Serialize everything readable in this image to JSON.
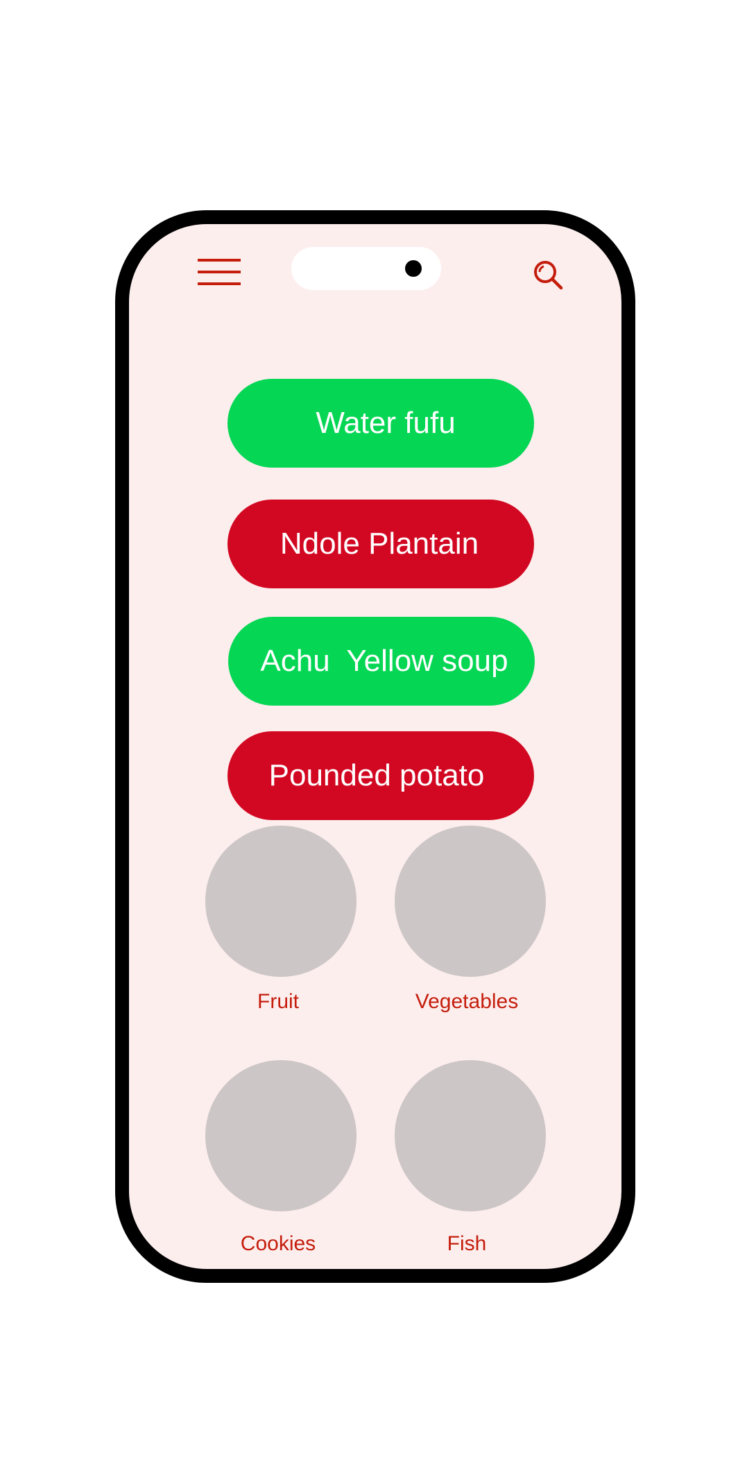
{
  "colors": {
    "accent": "#c41d0c",
    "green_button": "#05d654",
    "red_button": "#d20822",
    "screen_background": "#fdeeee",
    "placeholder": "#cdc6c6",
    "frame": "#000000"
  },
  "header": {
    "menu_icon": "hamburger-menu-icon",
    "search_icon": "search-icon"
  },
  "food_buttons": [
    {
      "label": "Water fufu",
      "color": "#05d654"
    },
    {
      "label": "Ndole Plantain",
      "color": "#d20822"
    },
    {
      "label": "Achu  Yellow soup",
      "color": "#05d654"
    },
    {
      "label": "Pounded potato",
      "color": "#d20822"
    }
  ],
  "categories": [
    {
      "label": "Fruit"
    },
    {
      "label": "Vegetables"
    },
    {
      "label": "Cookies"
    },
    {
      "label": "Fish"
    }
  ]
}
